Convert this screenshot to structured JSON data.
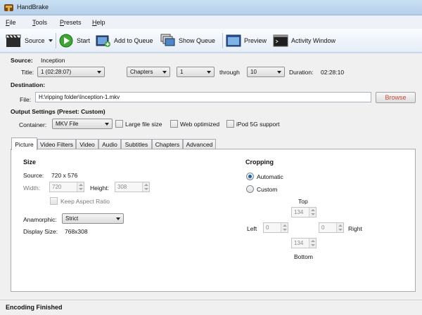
{
  "window": {
    "title": "HandBrake"
  },
  "menu": [
    {
      "mn": "F",
      "rest": "ile"
    },
    {
      "mn": "T",
      "rest": "ools"
    },
    {
      "mn": "P",
      "rest": "resets"
    },
    {
      "mn": "H",
      "rest": "elp"
    }
  ],
  "toolbar": {
    "source": "Source",
    "start": "Start",
    "add_queue": "Add to Queue",
    "show_queue": "Show Queue",
    "preview": "Preview",
    "activity": "Activity Window"
  },
  "source": {
    "label": "Source:",
    "value": "Inception",
    "title_label": "Title:",
    "title_value": "1 (02:28:07)",
    "chapters_mode": "Chapters",
    "chapter_start": "1",
    "through": "through",
    "chapter_end": "10",
    "duration_label": "Duration:",
    "duration_value": "02:28:10"
  },
  "destination": {
    "label": "Destination:",
    "file_label": "File:",
    "file_value": "H:\\ripping folder\\Inception-1.mkv",
    "browse": "Browse"
  },
  "output": {
    "label": "Output Settings (Preset: Custom)",
    "container_label": "Container:",
    "container_value": "MKV File",
    "large_file": "Large file size",
    "web_optimized": "Web optimized",
    "ipod": "iPod 5G support"
  },
  "tabs": [
    "Picture",
    "Video Filters",
    "Video",
    "Audio",
    "Subtitles",
    "Chapters",
    "Advanced"
  ],
  "picture": {
    "size_heading": "Size",
    "source_label": "Source:",
    "source_value": "720 x 576",
    "width_label": "Width:",
    "width_value": "720",
    "height_label": "Height:",
    "height_value": "308",
    "keep_aspect": "Keep Aspect Ratio",
    "anamorphic_label": "Anamorphic:",
    "anamorphic_value": "Strict",
    "display_label": "Display Size:",
    "display_value": "768x308"
  },
  "cropping": {
    "heading": "Cropping",
    "automatic": "Automatic",
    "custom": "Custom",
    "top_label": "Top",
    "top": "134",
    "left_label": "Left",
    "left": "0",
    "right_label": "Right",
    "right": "0",
    "bottom_label": "Bottom",
    "bottom": "134"
  },
  "status": "Encoding Finished",
  "colors": {
    "browse_text": "#c8463a",
    "accent": "#1d5fa8"
  }
}
